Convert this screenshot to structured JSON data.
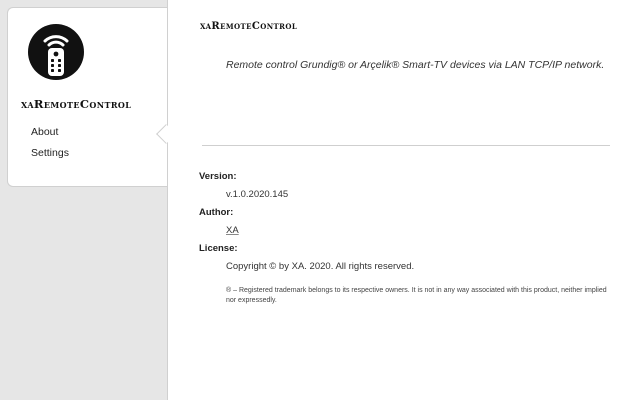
{
  "sidebar": {
    "logo_icon": "remote-control-icon",
    "app_title": "xaRemoteControl",
    "items": [
      {
        "label": "About",
        "selected": true
      },
      {
        "label": "Settings",
        "selected": false
      }
    ]
  },
  "main": {
    "title": "xaRemoteControl",
    "description": "Remote control Grundig® or Arçelik® Smart-TV devices via LAN TCP/IP network.",
    "version_label": "Version:",
    "version_value": "v.1.0.2020.145",
    "author_label": "Author:",
    "author_value": "XA",
    "license_label": "License:",
    "license_value": "Copyright © by XA. 2020. All rights reserved.",
    "footnote": "® – Registered trademark belongs to its respective owners. It is not in any way associated with this product, neither implied nor expressedly."
  }
}
